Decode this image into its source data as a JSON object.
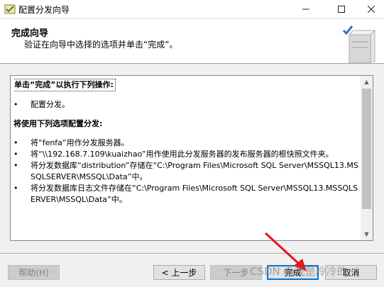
{
  "window": {
    "title": "配置分发向导",
    "icons": {
      "app": "wizard-app-icon",
      "minimize": "minimize-icon",
      "maximize": "maximize-icon",
      "close": "close-icon"
    }
  },
  "header": {
    "title": "完成向导",
    "subtitle": "验证在向导中选择的选项并单击“完成”。"
  },
  "content": {
    "heading1": "单击“完成”以执行下列操作:",
    "actions": [
      "配置分发。"
    ],
    "heading2": "将使用下列选项配置分发:",
    "options": [
      "将“fenfa”用作分发服务器。",
      "将“\\\\192.168.7.109\\kuaizhao”用作使用此分发服务器的发布服务器的根快照文件夹。",
      "将分发数据库“distribution”存储在“C:\\Program Files\\Microsoft SQL Server\\MSSQL13.MSSQLSERVER\\MSSQL\\Data”中。",
      "将分发数据库日志文件存储在“C:\\Program Files\\Microsoft SQL Server\\MSSQL13.MSSQLSERVER\\MSSQL\\Data”中。"
    ]
  },
  "buttons": {
    "help": "帮助(H)",
    "back": "< 上一步",
    "next": "下一步",
    "finish": "完成",
    "cancel": "取消"
  },
  "watermark": "CSDN @我是冷冷的...",
  "colors": {
    "accent": "#0078d7",
    "annotation_arrow": "#e8141c"
  }
}
